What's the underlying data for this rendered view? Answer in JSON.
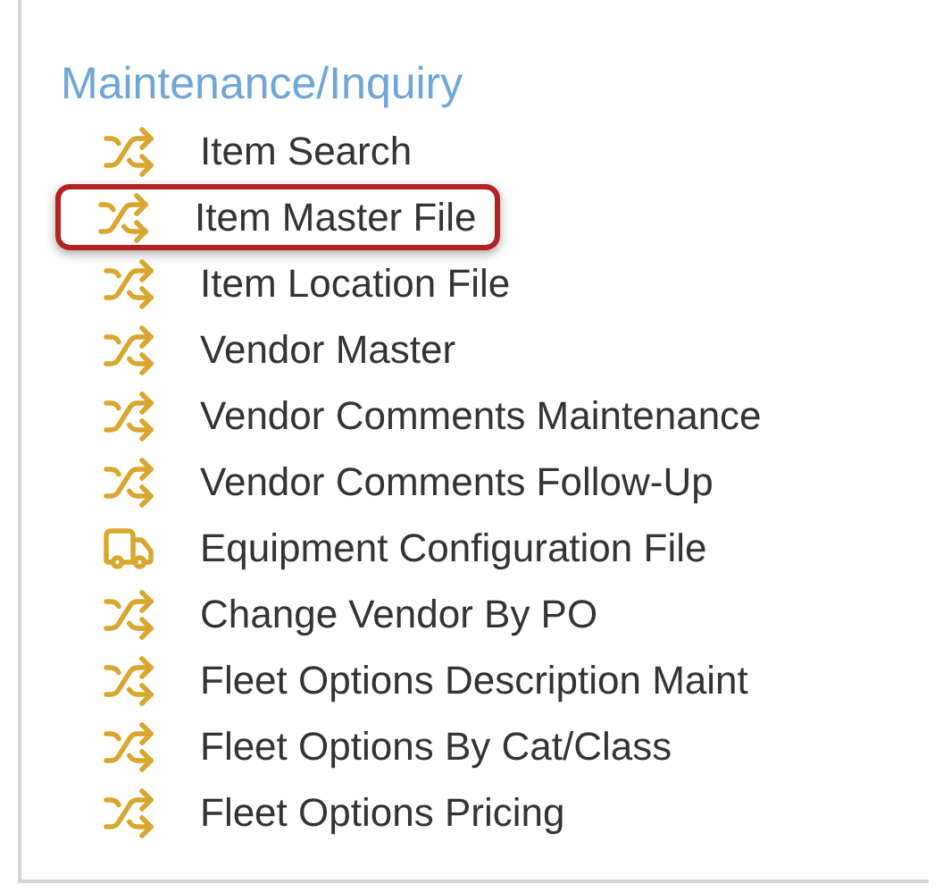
{
  "heading": "Maintenance/Inquiry",
  "items": [
    {
      "label": "Item Search",
      "kind": "shuffle",
      "highlighted": false
    },
    {
      "label": "Item Master File",
      "kind": "shuffle",
      "highlighted": true
    },
    {
      "label": "Item Location File",
      "kind": "shuffle",
      "highlighted": false
    },
    {
      "label": "Vendor Master",
      "kind": "shuffle",
      "highlighted": false
    },
    {
      "label": "Vendor Comments Maintenance",
      "kind": "shuffle",
      "highlighted": false
    },
    {
      "label": "Vendor Comments Follow-Up",
      "kind": "shuffle",
      "highlighted": false
    },
    {
      "label": "Equipment Configuration File",
      "kind": "truck",
      "highlighted": false
    },
    {
      "label": "Change Vendor By PO",
      "kind": "shuffle",
      "highlighted": false
    },
    {
      "label": "Fleet Options Description Maint",
      "kind": "shuffle",
      "highlighted": false
    },
    {
      "label": "Fleet Options By Cat/Class",
      "kind": "shuffle",
      "highlighted": false
    },
    {
      "label": "Fleet Options Pricing",
      "kind": "shuffle",
      "highlighted": false
    }
  ]
}
